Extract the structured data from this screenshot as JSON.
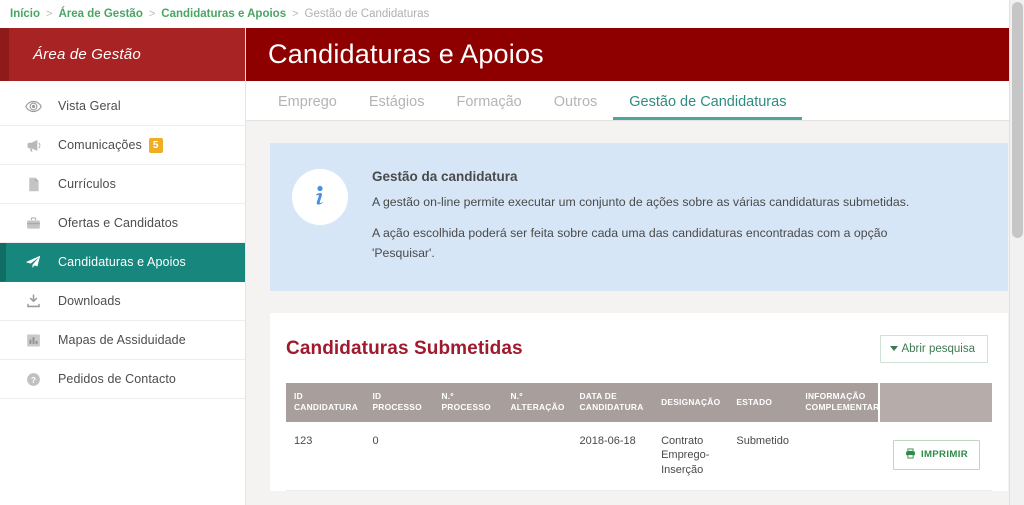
{
  "breadcrumb": {
    "items": [
      {
        "label": "Início",
        "current": false
      },
      {
        "label": "Área de Gestão",
        "current": false
      },
      {
        "label": "Candidaturas e Apoios",
        "current": false
      },
      {
        "label": "Gestão de Candidaturas",
        "current": true
      }
    ],
    "separator": ">"
  },
  "sidebar": {
    "header_title": "Área de Gestão",
    "items": [
      {
        "label": "Vista Geral",
        "icon": "eye-icon",
        "badge": null,
        "active": false
      },
      {
        "label": "Comunicações",
        "icon": "megaphone-icon",
        "badge": "5",
        "active": false
      },
      {
        "label": "Currículos",
        "icon": "document-icon",
        "badge": null,
        "active": false
      },
      {
        "label": "Ofertas e Candidatos",
        "icon": "briefcase-icon",
        "badge": null,
        "active": false
      },
      {
        "label": "Candidaturas e Apoios",
        "icon": "paper-plane-icon",
        "badge": null,
        "active": true
      },
      {
        "label": "Downloads",
        "icon": "download-icon",
        "badge": null,
        "active": false
      },
      {
        "label": "Mapas de Assiduidade",
        "icon": "bar-chart-icon",
        "badge": null,
        "active": false
      },
      {
        "label": "Pedidos de Contacto",
        "icon": "question-circle-icon",
        "badge": null,
        "active": false
      }
    ]
  },
  "header": {
    "title": "Candidaturas e Apoios"
  },
  "tabs": [
    {
      "label": "Emprego",
      "active": false
    },
    {
      "label": "Estágios",
      "active": false
    },
    {
      "label": "Formação",
      "active": false
    },
    {
      "label": "Outros",
      "active": false
    },
    {
      "label": "Gestão de Candidaturas",
      "active": true
    }
  ],
  "info_panel": {
    "icon": "info-circle-icon",
    "title": "Gestão da candidatura",
    "paragraphs": [
      "A gestão on-line permite executar um conjunto de ações sobre as várias candidaturas submetidas.",
      "A ação escolhida poderá ser feita sobre cada uma das candidaturas encontradas com a opção 'Pesquisar'."
    ]
  },
  "card": {
    "title": "Candidaturas Submetidas",
    "search_button": {
      "label": "Abrir pesquisa",
      "icon": "caret-down-icon"
    }
  },
  "table": {
    "columns": [
      "ID CANDIDATURA",
      "ID PROCESSO",
      "N.º PROCESSO",
      "N.º ALTERAÇÃO",
      "DATA DE CANDIDATURA",
      "DESIGNAÇÃO",
      "ESTADO",
      "INFORMAÇÃO COMPLEMENTAR",
      ""
    ],
    "rows": [
      {
        "id_candidatura": "123",
        "id_processo": "0",
        "n_processo": "",
        "n_alteracao": "",
        "data_candidatura": "2018-06-18",
        "designacao": "Contrato Emprego-Inserção",
        "estado": "Submetido",
        "informacao_complementar": "",
        "action": {
          "label": "IMPRIMIR",
          "icon": "printer-icon"
        }
      }
    ]
  },
  "colors": {
    "header_red": "#8e0000",
    "sidebar_header_red": "#a82323",
    "active_teal": "#17867c",
    "tab_active_teal": "#2d8c82",
    "breadcrumb_green": "#4aa564",
    "badge_orange": "#f0ad26",
    "info_panel_blue": "#d6e6f7",
    "card_title_red": "#a01a2e",
    "table_header_grey": "#a89f9c",
    "print_green": "#2f8a4a"
  },
  "scrollbar": {
    "present": true
  }
}
